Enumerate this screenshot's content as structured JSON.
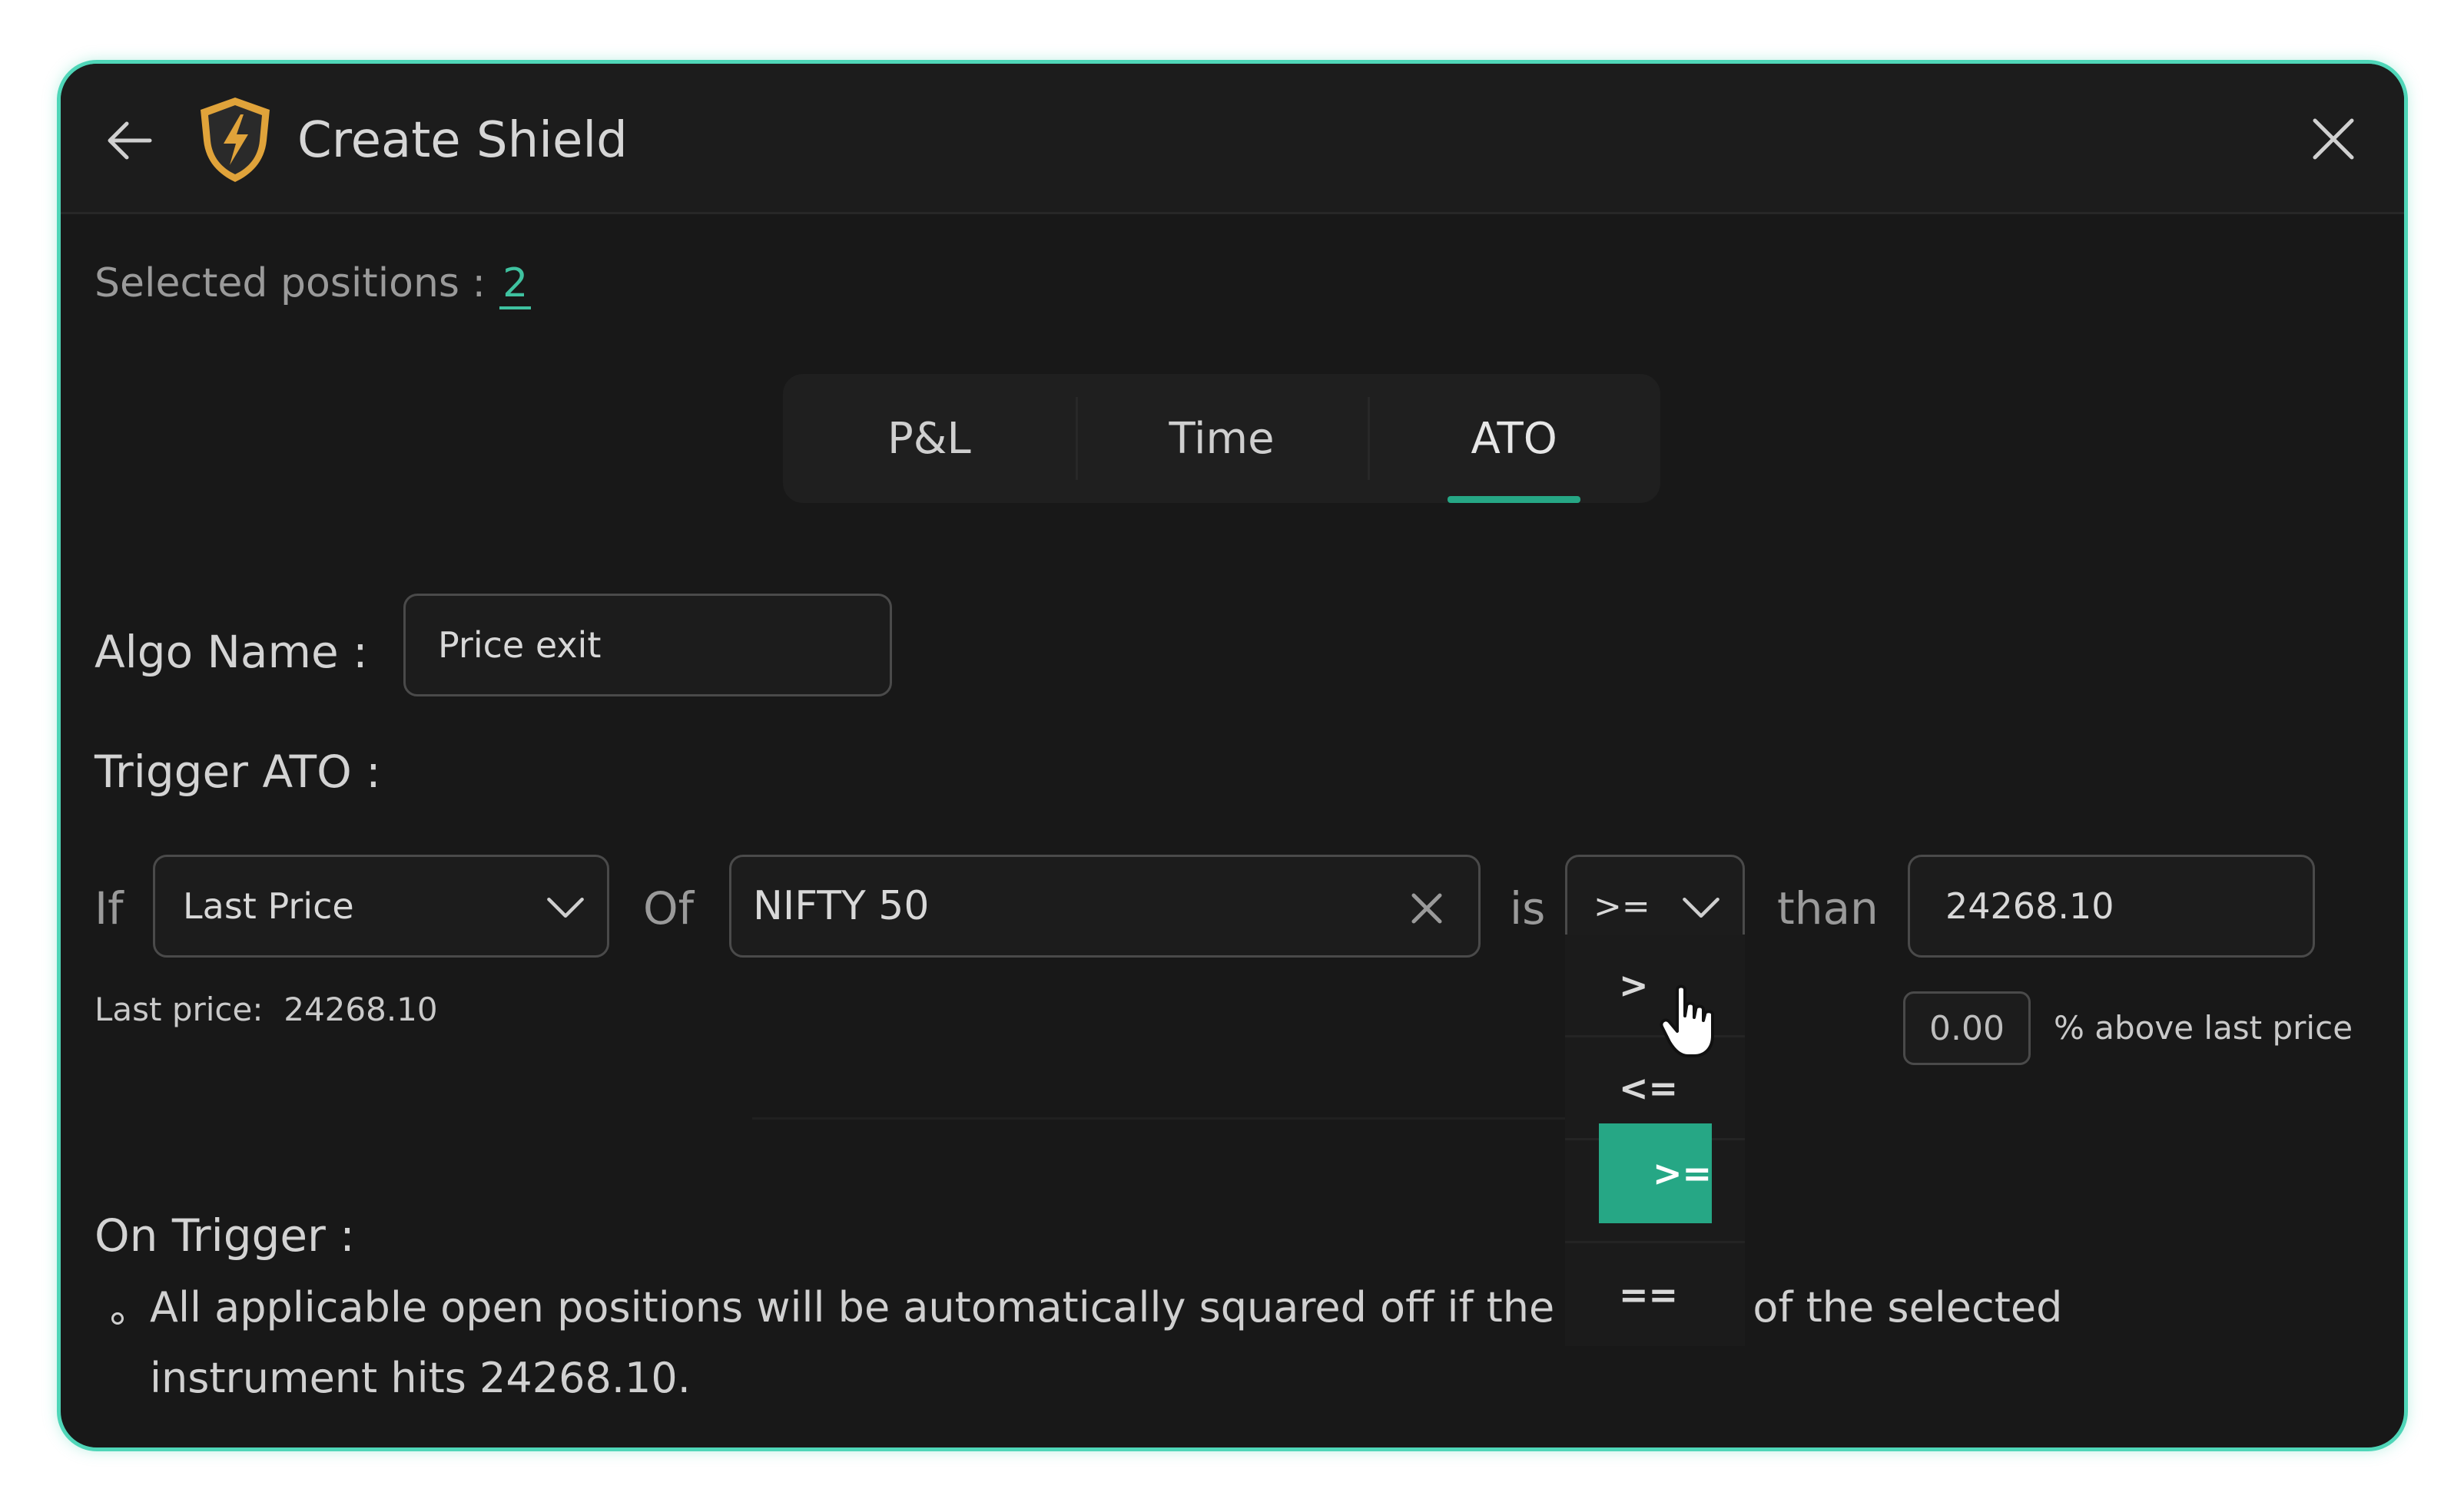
{
  "header": {
    "title": "Create Shield",
    "back_icon": "back-arrow-icon",
    "logo_icon": "shield-bolt-icon",
    "close_icon": "close-icon"
  },
  "selected_positions": {
    "label": "Selected positions :",
    "count": "2"
  },
  "tabs": [
    {
      "label": "P&L",
      "active": false
    },
    {
      "label": "Time",
      "active": false
    },
    {
      "label": "ATO",
      "active": true
    }
  ],
  "algo": {
    "label": "Algo Name :",
    "value": "Price exit"
  },
  "trigger": {
    "label": "Trigger ATO :",
    "if_label": "If",
    "field_value": "Last Price",
    "of_label": "Of",
    "instrument_value": "NIFTY 50",
    "is_label": "is",
    "operator_value": ">=",
    "than_label": "than",
    "price_value": "24268.10",
    "last_price_label": "Last price:",
    "last_price_value": "24268.10",
    "percent_value": "0.00",
    "percent_label": "% above last price"
  },
  "operator_options": [
    ">=",
    ">",
    "<=",
    "<",
    "=="
  ],
  "selected_operator_index": 0,
  "on_trigger": {
    "label": "On Trigger :",
    "description_part1": "All applicable open positions will be automatically squared off if the l",
    "description_part2": "of the selected",
    "description_line2": "instrument hits 24268.10."
  },
  "colors": {
    "accent": "#26a785",
    "border_glow": "#4fd6b8",
    "background": "#181818",
    "shield_gold": "#e0a33a"
  }
}
